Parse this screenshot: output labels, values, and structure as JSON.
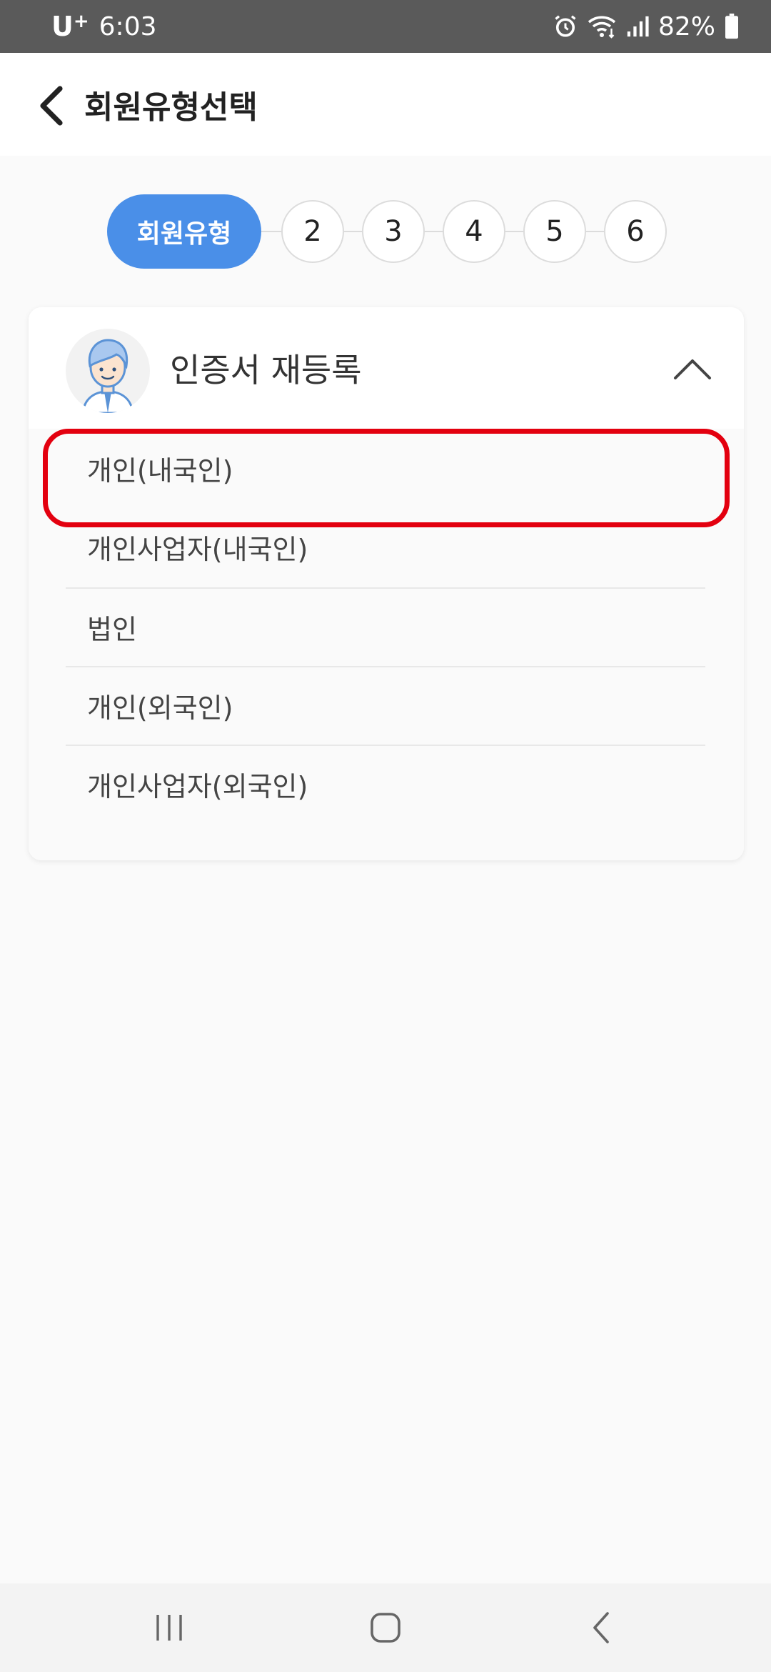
{
  "status_bar": {
    "carrier": "U",
    "carrier_plus": "+",
    "time": "6:03",
    "battery": "82%"
  },
  "header": {
    "title": "회원유형선택"
  },
  "steps": {
    "active_label": "회원유형",
    "items": [
      "2",
      "3",
      "4",
      "5",
      "6"
    ]
  },
  "card": {
    "title": "인증서 재등록",
    "options": [
      "개인(내국인)",
      "개인사업자(내국인)",
      "법인",
      "개인(외국인)",
      "개인사업자(외국인)"
    ]
  },
  "colors": {
    "accent": "#4a8fe8",
    "highlight": "#e3000f"
  }
}
